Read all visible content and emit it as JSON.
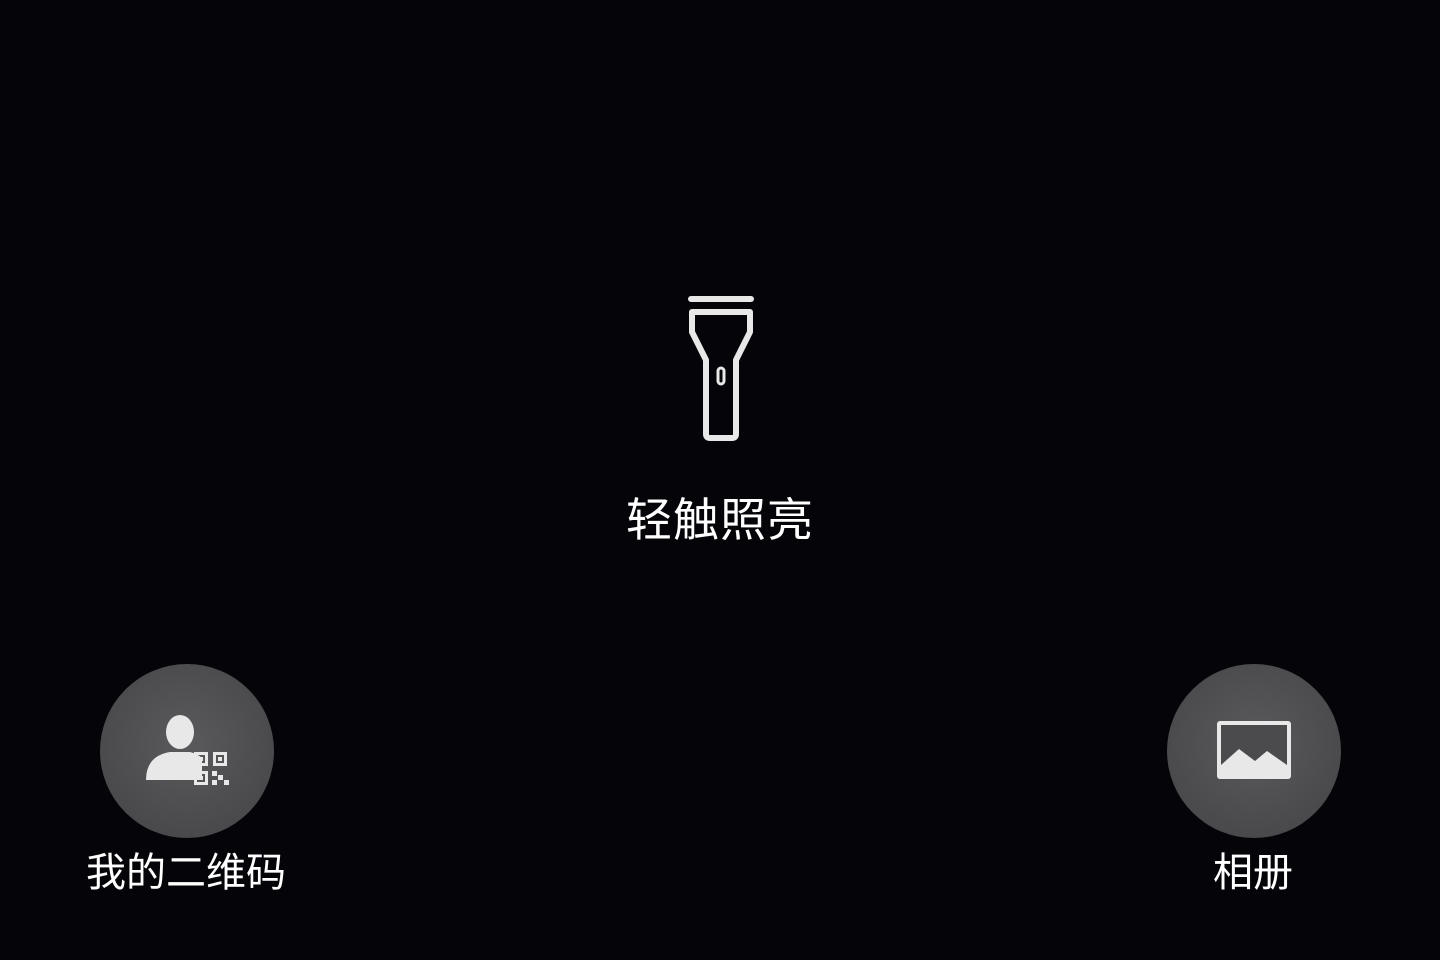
{
  "flashlight": {
    "label": "轻触照亮",
    "icon": "flashlight-icon"
  },
  "bottom_actions": {
    "my_qr_code": {
      "label": "我的二维码",
      "icon": "user-qr-code-icon"
    },
    "album": {
      "label": "相册",
      "icon": "image-icon"
    }
  },
  "colors": {
    "background": "#050408",
    "button_fill": "#4a494c",
    "foreground": "#ffffff",
    "icon": "#e8e8e8"
  }
}
